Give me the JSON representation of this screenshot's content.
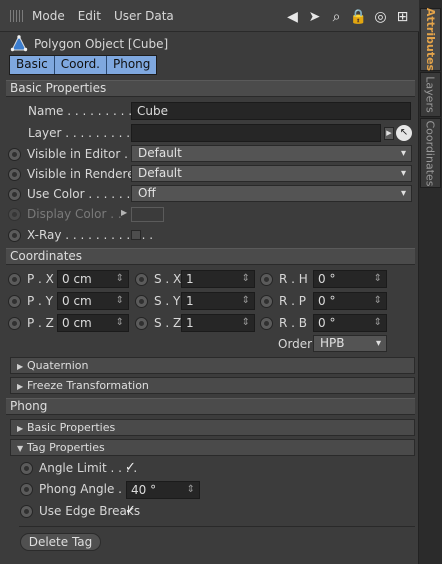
{
  "menu": {
    "items": [
      "Mode",
      "Edit",
      "User Data"
    ],
    "tool_icons": [
      "back-arrow-icon",
      "cursor-icon",
      "search-icon",
      "lock-icon",
      "target-icon",
      "add-icon"
    ]
  },
  "object": {
    "title": "Polygon Object [Cube]",
    "tabs": [
      "Basic",
      "Coord.",
      "Phong"
    ]
  },
  "sections": {
    "basic": "Basic Properties",
    "coordinates": "Coordinates",
    "phong": "Phong"
  },
  "basic": {
    "name_label": "Name . . . . . . . . . . .",
    "name_value": "Cube",
    "layer_label": "Layer . . . . . . . . . . .",
    "visible_editor_label": "Visible in Editor . .",
    "visible_editor_value": "Default",
    "visible_renderer_label": "Visible in Renderer",
    "visible_renderer_value": "Default",
    "use_color_label": "Use Color . . . . . . . .",
    "use_color_value": "Off",
    "display_color_label": "Display Color . .",
    "xray_label": "X-Ray . . . . . . . . . . . ."
  },
  "coordinates": {
    "px_label": "P . X",
    "py_label": "P . Y",
    "pz_label": "P . Z",
    "sx_label": "S . X",
    "sy_label": "S . Y",
    "sz_label": "S . Z",
    "rh_label": "R . H",
    "rp_label": "R . P",
    "rb_label": "R . B",
    "px": "0 cm",
    "py": "0 cm",
    "pz": "0 cm",
    "sx": "1",
    "sy": "1",
    "sz": "1",
    "rh": "0 °",
    "rp": "0 °",
    "rb": "0 °",
    "order_label": "Order",
    "order_value": "HPB",
    "quaternion": "Quaternion",
    "freeze": "Freeze Transformation"
  },
  "phong": {
    "basic_properties": "Basic Properties",
    "tag_properties": "Tag Properties",
    "angle_limit_label": "Angle Limit . . . .",
    "phong_angle_label": "Phong Angle . . .",
    "phong_angle_value": "40 °",
    "edge_breaks_label": "Use Edge Breaks",
    "delete_tag": "Delete Tag"
  },
  "side_tabs": [
    "Attributes",
    "Layers",
    "Coordinates"
  ],
  "colors": {
    "accent_tab": "#7fa8df",
    "active_side_tab": "#e3a34a",
    "panel": "#3c3c3c"
  }
}
